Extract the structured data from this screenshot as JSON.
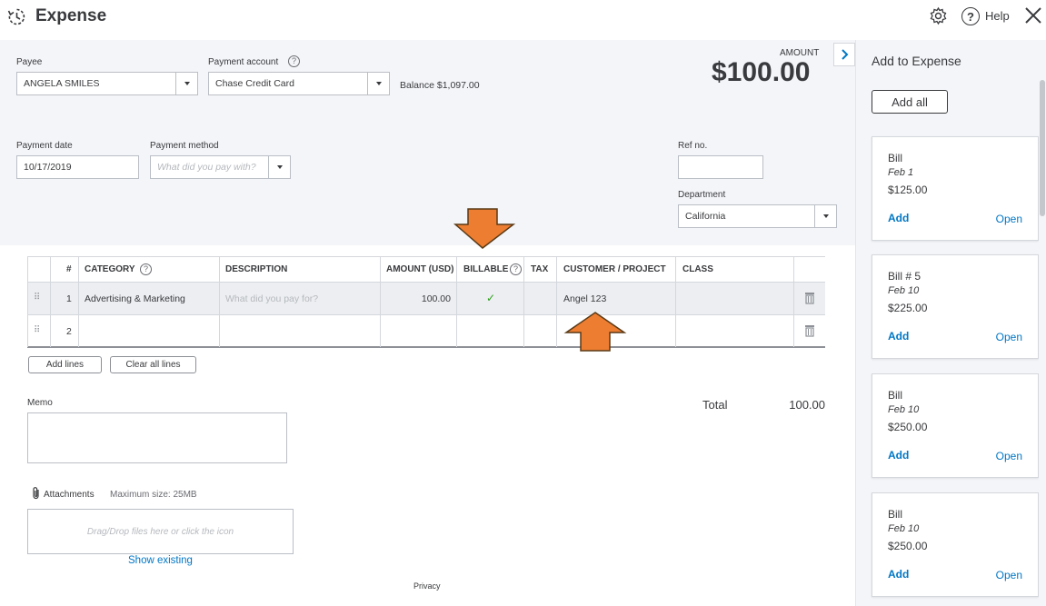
{
  "app": {
    "title": "Expense",
    "help_label": "Help"
  },
  "form": {
    "payee_label": "Payee",
    "payee_value": "ANGELA SMILES",
    "payment_account_label": "Payment account",
    "payment_account_value": "Chase Credit Card",
    "balance_label": "Balance",
    "balance_value": "$1,097.00",
    "amount_label": "AMOUNT",
    "amount_value": "$100.00",
    "payment_date_label": "Payment date",
    "payment_date_value": "10/17/2019",
    "payment_method_label": "Payment method",
    "payment_method_placeholder": "What did you pay with?",
    "ref_label": "Ref no.",
    "ref_value": "",
    "department_label": "Department",
    "department_value": "California"
  },
  "table": {
    "headers": [
      "#",
      "CATEGORY",
      "DESCRIPTION",
      "AMOUNT (USD)",
      "BILLABLE",
      "TAX",
      "CUSTOMER / PROJECT",
      "CLASS"
    ],
    "rows": [
      {
        "num": "1",
        "category": "Advertising & Marketing",
        "description_placeholder": "What did you pay for?",
        "amount": "100.00",
        "billable": "✓",
        "customer": "Angel 123"
      },
      {
        "num": "2",
        "category": "",
        "description_placeholder": "",
        "amount": "",
        "billable": "",
        "customer": ""
      }
    ],
    "add_lines_label": "Add lines",
    "clear_lines_label": "Clear all lines"
  },
  "footer": {
    "memo_label": "Memo",
    "total_label": "Total",
    "total_value": "100.00",
    "attachments_label": "Attachments",
    "max_size_label": "Maximum size: 25MB",
    "drop_text": "Drag/Drop files here or click the icon",
    "show_existing": "Show existing",
    "privacy": "Privacy"
  },
  "sidebar": {
    "title": "Add to Expense",
    "add_all_label": "Add all",
    "cards": [
      {
        "type": "Bill",
        "date": "Feb 1",
        "amount": "$125.00",
        "add": "Add",
        "open": "Open"
      },
      {
        "type": "Bill # 5",
        "date": "Feb 10",
        "amount": "$225.00",
        "add": "Add",
        "open": "Open"
      },
      {
        "type": "Bill",
        "date": "Feb 10",
        "amount": "$250.00",
        "add": "Add",
        "open": "Open"
      },
      {
        "type": "Bill",
        "date": "Feb 10",
        "amount": "$250.00",
        "add": "Add",
        "open": "Open"
      }
    ]
  },
  "colors": {
    "link": "#0077c5",
    "arrow": "#ed7d31",
    "check": "#2ca01c"
  }
}
